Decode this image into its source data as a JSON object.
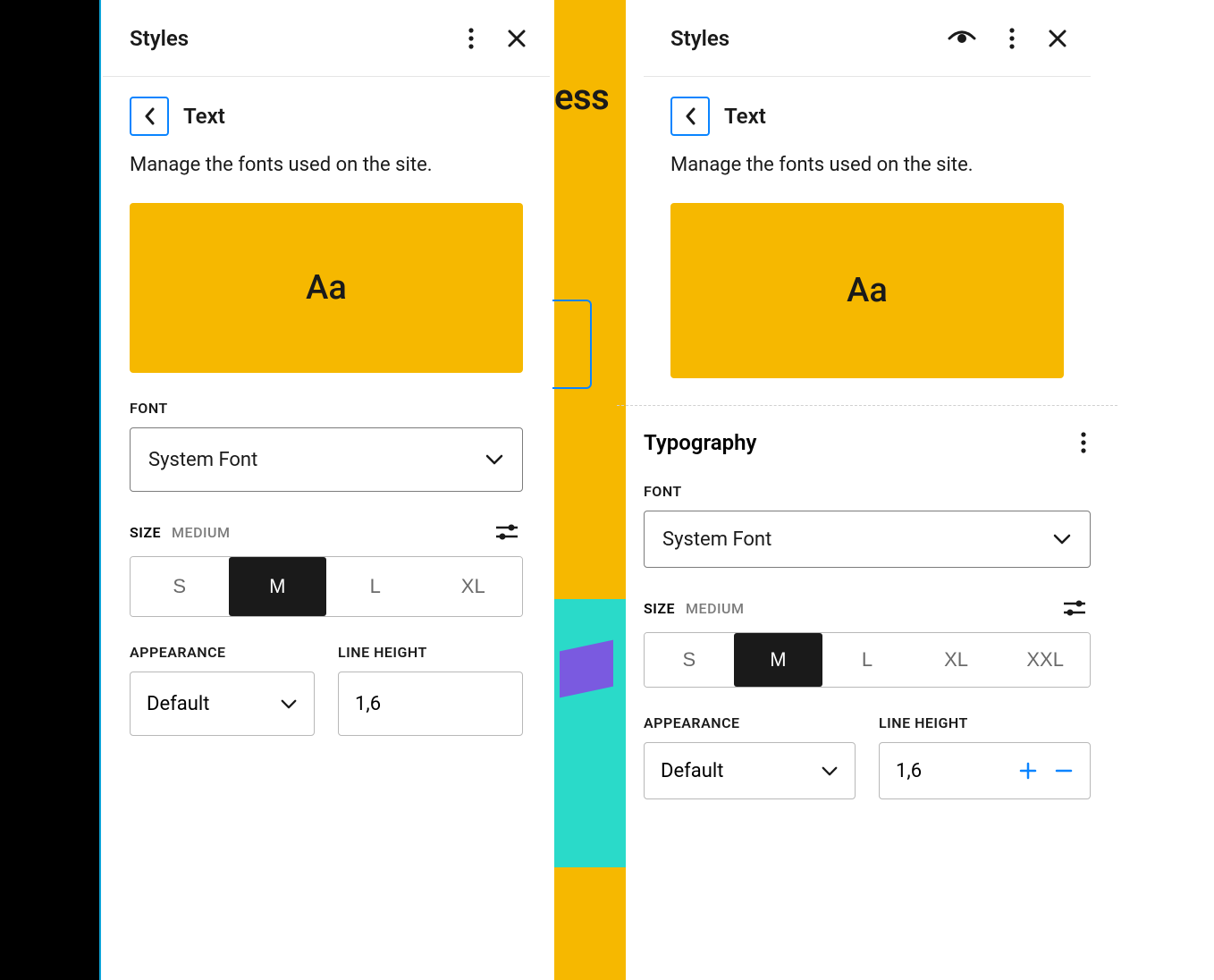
{
  "left": {
    "header": {
      "title": "Styles"
    },
    "back_label": "Text",
    "description": "Manage the fonts used on the site.",
    "preview_text": "Aa",
    "font_label": "FONT",
    "font_value": "System Font",
    "size_label": "SIZE",
    "size_value": "MEDIUM",
    "size_options": [
      "S",
      "M",
      "L",
      "XL"
    ],
    "size_selected": "M",
    "appearance_label": "APPEARANCE",
    "appearance_value": "Default",
    "lineheight_label": "LINE HEIGHT",
    "lineheight_value": "1,6"
  },
  "right": {
    "header": {
      "title": "Styles"
    },
    "back_label": "Text",
    "description": "Manage the fonts used on the site.",
    "preview_text": "Aa",
    "typography_label": "Typography",
    "font_label": "FONT",
    "font_value": "System Font",
    "size_label": "SIZE",
    "size_value": "MEDIUM",
    "size_options": [
      "S",
      "M",
      "L",
      "XL",
      "XXL"
    ],
    "size_selected": "M",
    "appearance_label": "APPEARANCE",
    "appearance_value": "Default",
    "lineheight_label": "LINE HEIGHT",
    "lineheight_value": "1,6"
  },
  "background": {
    "partial_text": "ess"
  }
}
